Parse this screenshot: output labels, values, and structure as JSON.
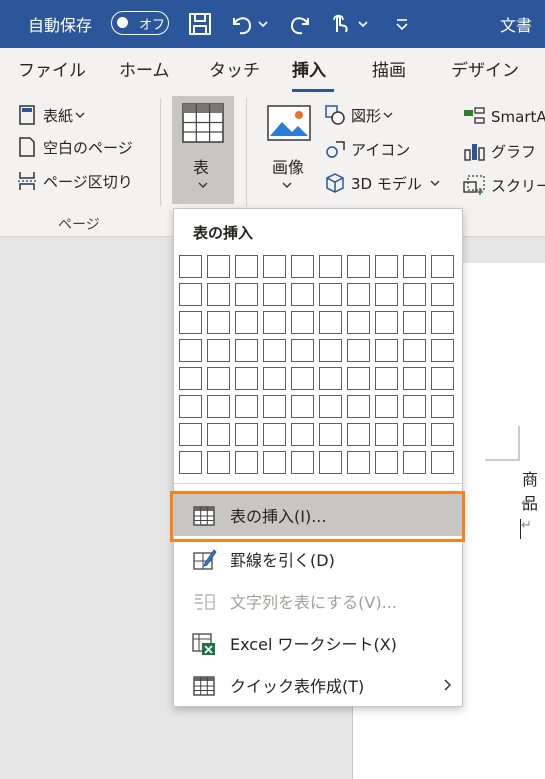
{
  "titlebar": {
    "autosave_label": "自動保存",
    "autosave_toggle": "オフ",
    "document_title": "文書"
  },
  "tabs": [
    "ファイル",
    "ホーム",
    "タッチ",
    "挿入",
    "描画",
    "デザイン"
  ],
  "active_tab": "挿入",
  "ribbon": {
    "pages": {
      "cover": "表紙",
      "blank_page": "空白のページ",
      "page_break": "ページ区切り",
      "group_label": "ページ"
    },
    "table": {
      "label": "表"
    },
    "image": {
      "label": "画像"
    },
    "illustrations": {
      "shapes": "図形",
      "icons": "アイコン",
      "models_3d": "3D モデル",
      "smartart": "SmartArt",
      "chart": "グラフ",
      "screenshot": "スクリーン"
    }
  },
  "dropdown": {
    "title": "表の挿入",
    "grid": {
      "columns": 10,
      "rows": 8
    },
    "items": [
      {
        "label": "表の挿入(I)...",
        "icon": "table-icon",
        "enabled": true,
        "highlighted": true
      },
      {
        "label": "罫線を引く(D)",
        "icon": "draw-table-icon",
        "enabled": true
      },
      {
        "label": "文字列を表にする(V)...",
        "icon": "convert-text-to-table-icon",
        "enabled": false
      },
      {
        "label": "Excel ワークシート(X)",
        "icon": "excel-sheet-icon",
        "enabled": true
      },
      {
        "label": "クイック表作成(T)",
        "icon": "quick-table-icon",
        "enabled": true,
        "submenu": true
      }
    ]
  },
  "document": {
    "text": "商品",
    "paragraph_mark": "↵"
  },
  "colors": {
    "titlebar": "#2b579a",
    "highlight_border": "#f5821f",
    "selected_item": "#c8c6c4"
  }
}
